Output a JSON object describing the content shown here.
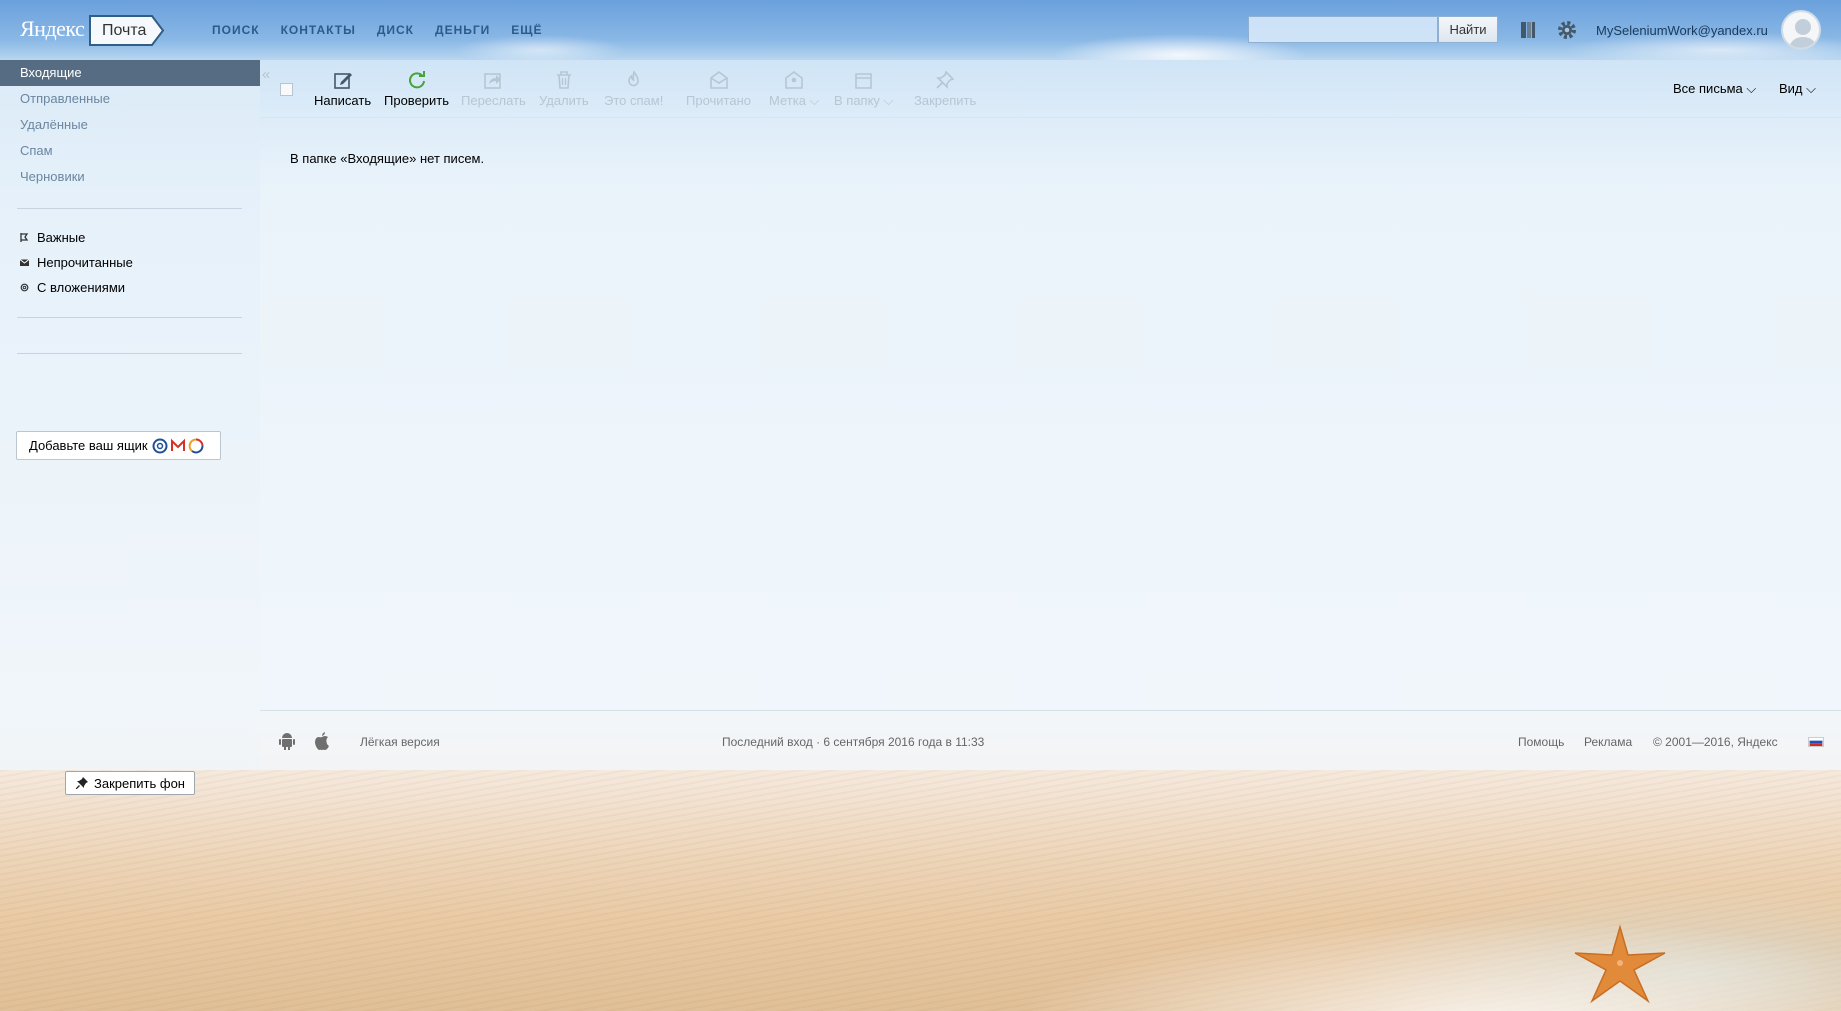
{
  "header": {
    "logo": "Яндекс",
    "service": "Почта",
    "nav": [
      "ПОИСК",
      "КОНТАКТЫ",
      "ДИСК",
      "ДЕНЬГИ",
      "ЕЩЁ"
    ],
    "search_placeholder": "",
    "search_button": "Найти",
    "user_email": "MySeleniumWork@yandex.ru"
  },
  "sidebar": {
    "folders": [
      "Входящие",
      "Отправленные",
      "Удалённые",
      "Спам",
      "Черновики"
    ],
    "active_folder": "Входящие",
    "filters": [
      "Важные",
      "Непрочитанные",
      "С вложениями"
    ],
    "add_mailbox": "Добавьте ваш ящик",
    "pin_background": "Закрепить фон"
  },
  "toolbar": {
    "buttons": [
      "Написать",
      "Проверить",
      "Переслать",
      "Удалить",
      "Это спам!",
      "Прочитано",
      "Метка",
      "В папку",
      "Закрепить"
    ],
    "all_letters": "Все письма",
    "view": "Вид"
  },
  "main": {
    "empty_message": "В папке «Входящие» нет писем."
  },
  "footer": {
    "light_version": "Лёгкая версия",
    "last_login": "Последний вход · 6 сентября 2016 года в 11:33",
    "help": "Помощь",
    "ads": "Реклама",
    "copyright": "© 2001—2016, Яндекс"
  },
  "colors": {
    "active_folder_bg": "#566c82",
    "nav_text": "#2b5b8c",
    "disabled_text": "#b7c6d3"
  }
}
